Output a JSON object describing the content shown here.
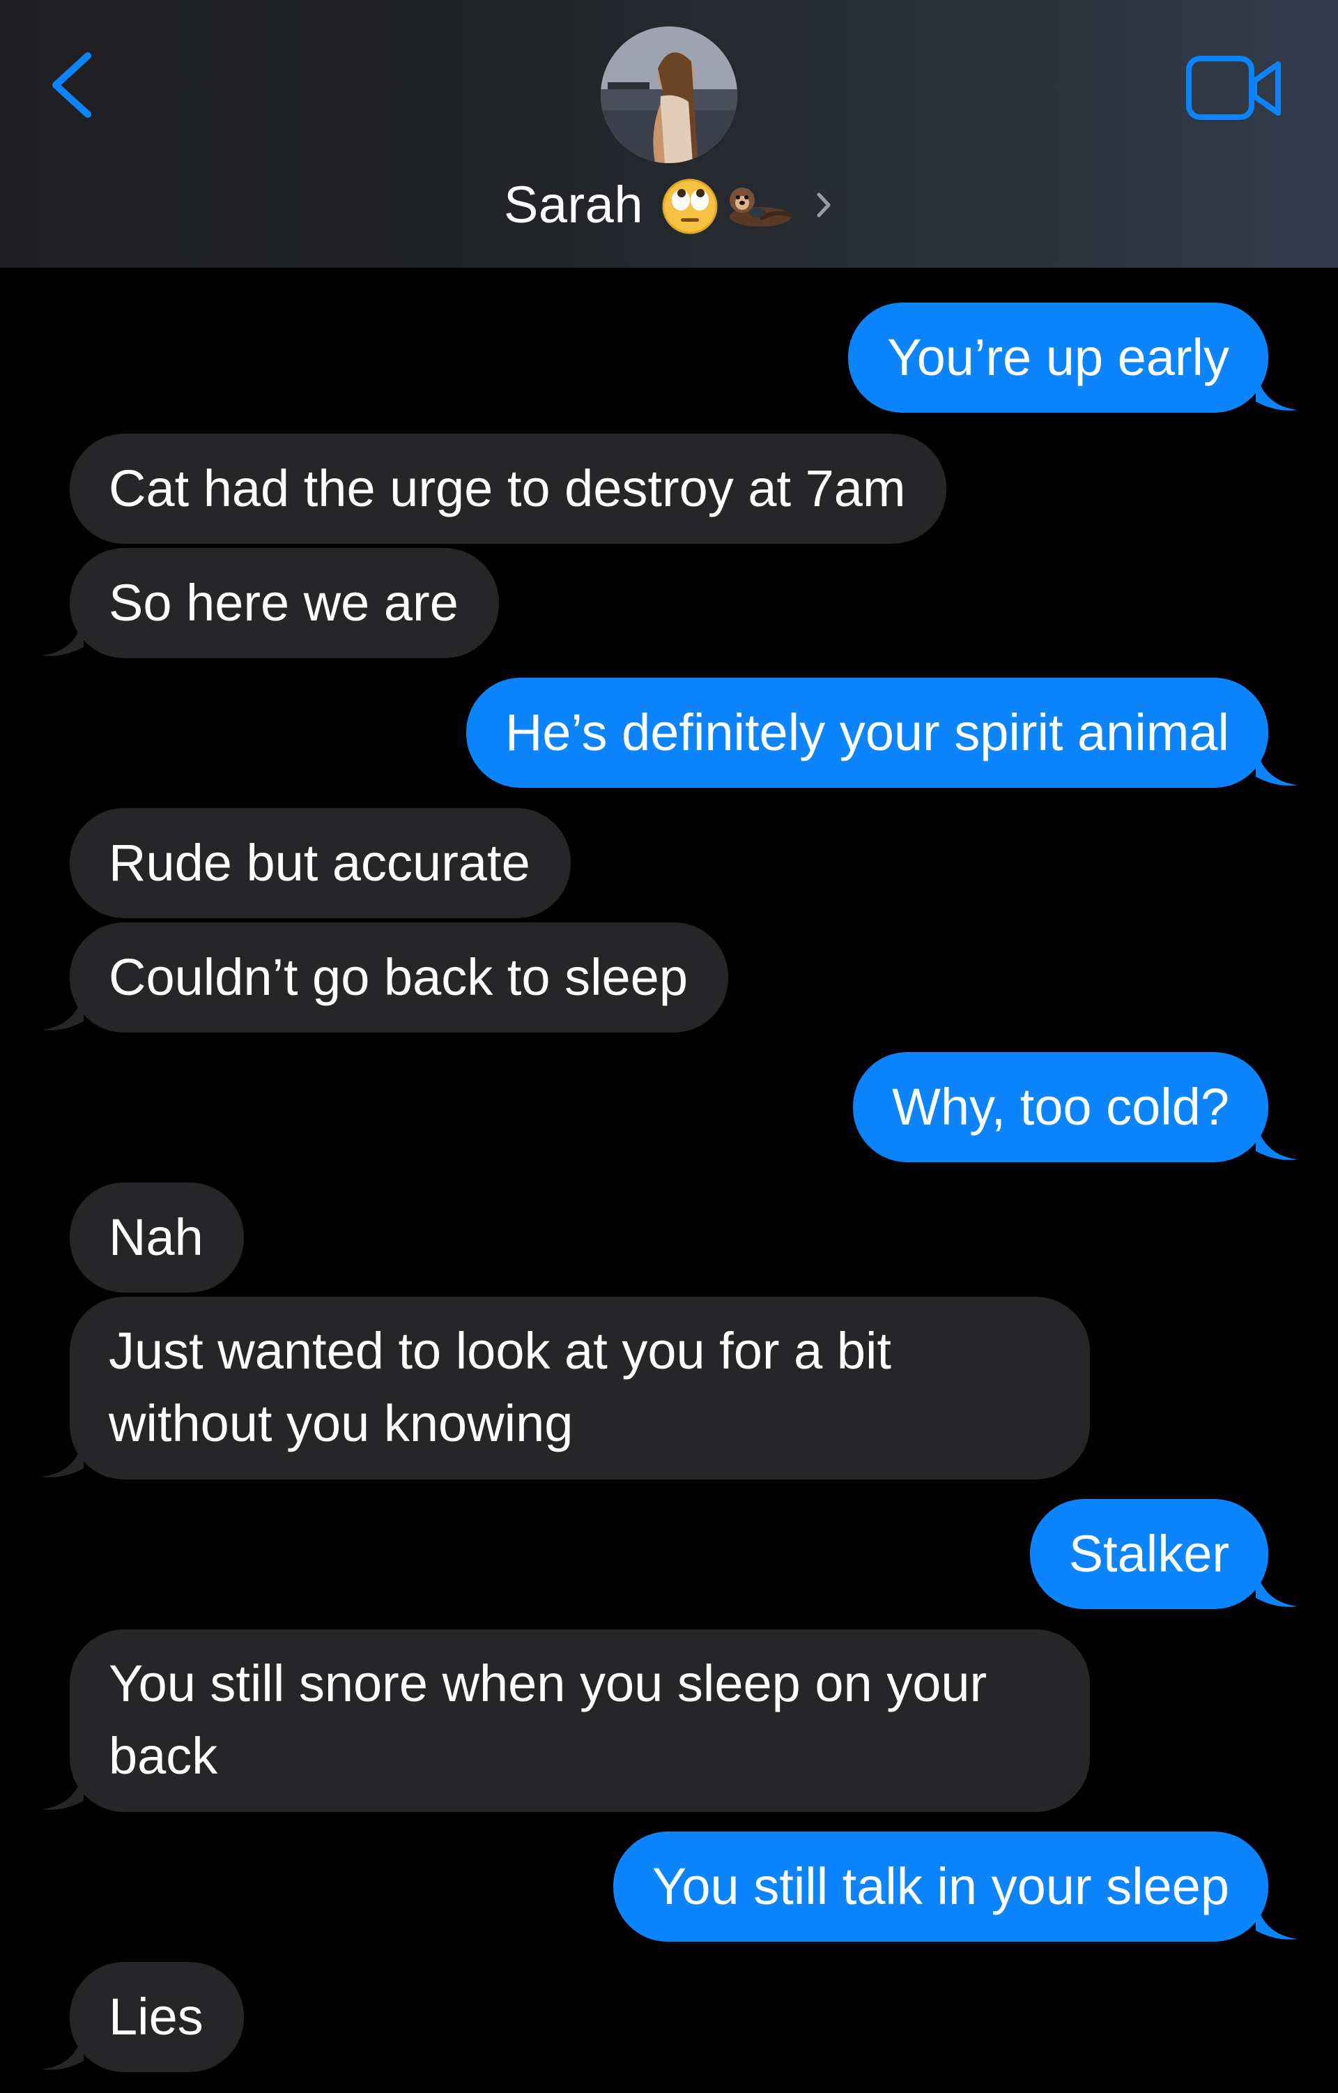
{
  "header": {
    "contact_name": "Sarah",
    "back_icon": "chevron-left-icon",
    "video_icon": "video-camera-icon",
    "disclosure_icon": "chevron-right-icon",
    "emojis": [
      "face-with-rolling-eyes",
      "otter"
    ],
    "accent_color": "#0b84fe"
  },
  "messages": [
    {
      "from": "me",
      "text": "You’re up early"
    },
    {
      "from": "them",
      "text": "Cat had the urge to destroy at 7am"
    },
    {
      "from": "them",
      "text": "So here we are"
    },
    {
      "from": "me",
      "text": "He’s definitely your spirit animal"
    },
    {
      "from": "them",
      "text": "Rude but accurate"
    },
    {
      "from": "them",
      "text": "Couldn’t go back to sleep"
    },
    {
      "from": "me",
      "text": "Why, too cold?"
    },
    {
      "from": "them",
      "text": "Nah"
    },
    {
      "from": "them",
      "text": "Just wanted to look at you for a bit without you knowing"
    },
    {
      "from": "me",
      "text": "Stalker"
    },
    {
      "from": "them",
      "text": "You still snore when you sleep on your back"
    },
    {
      "from": "me",
      "text": "You still talk in your sleep"
    },
    {
      "from": "them",
      "text": "Lies"
    }
  ],
  "colors": {
    "sent_bubble": "#0b84fe",
    "received_bubble": "#262629",
    "background": "#000000"
  }
}
